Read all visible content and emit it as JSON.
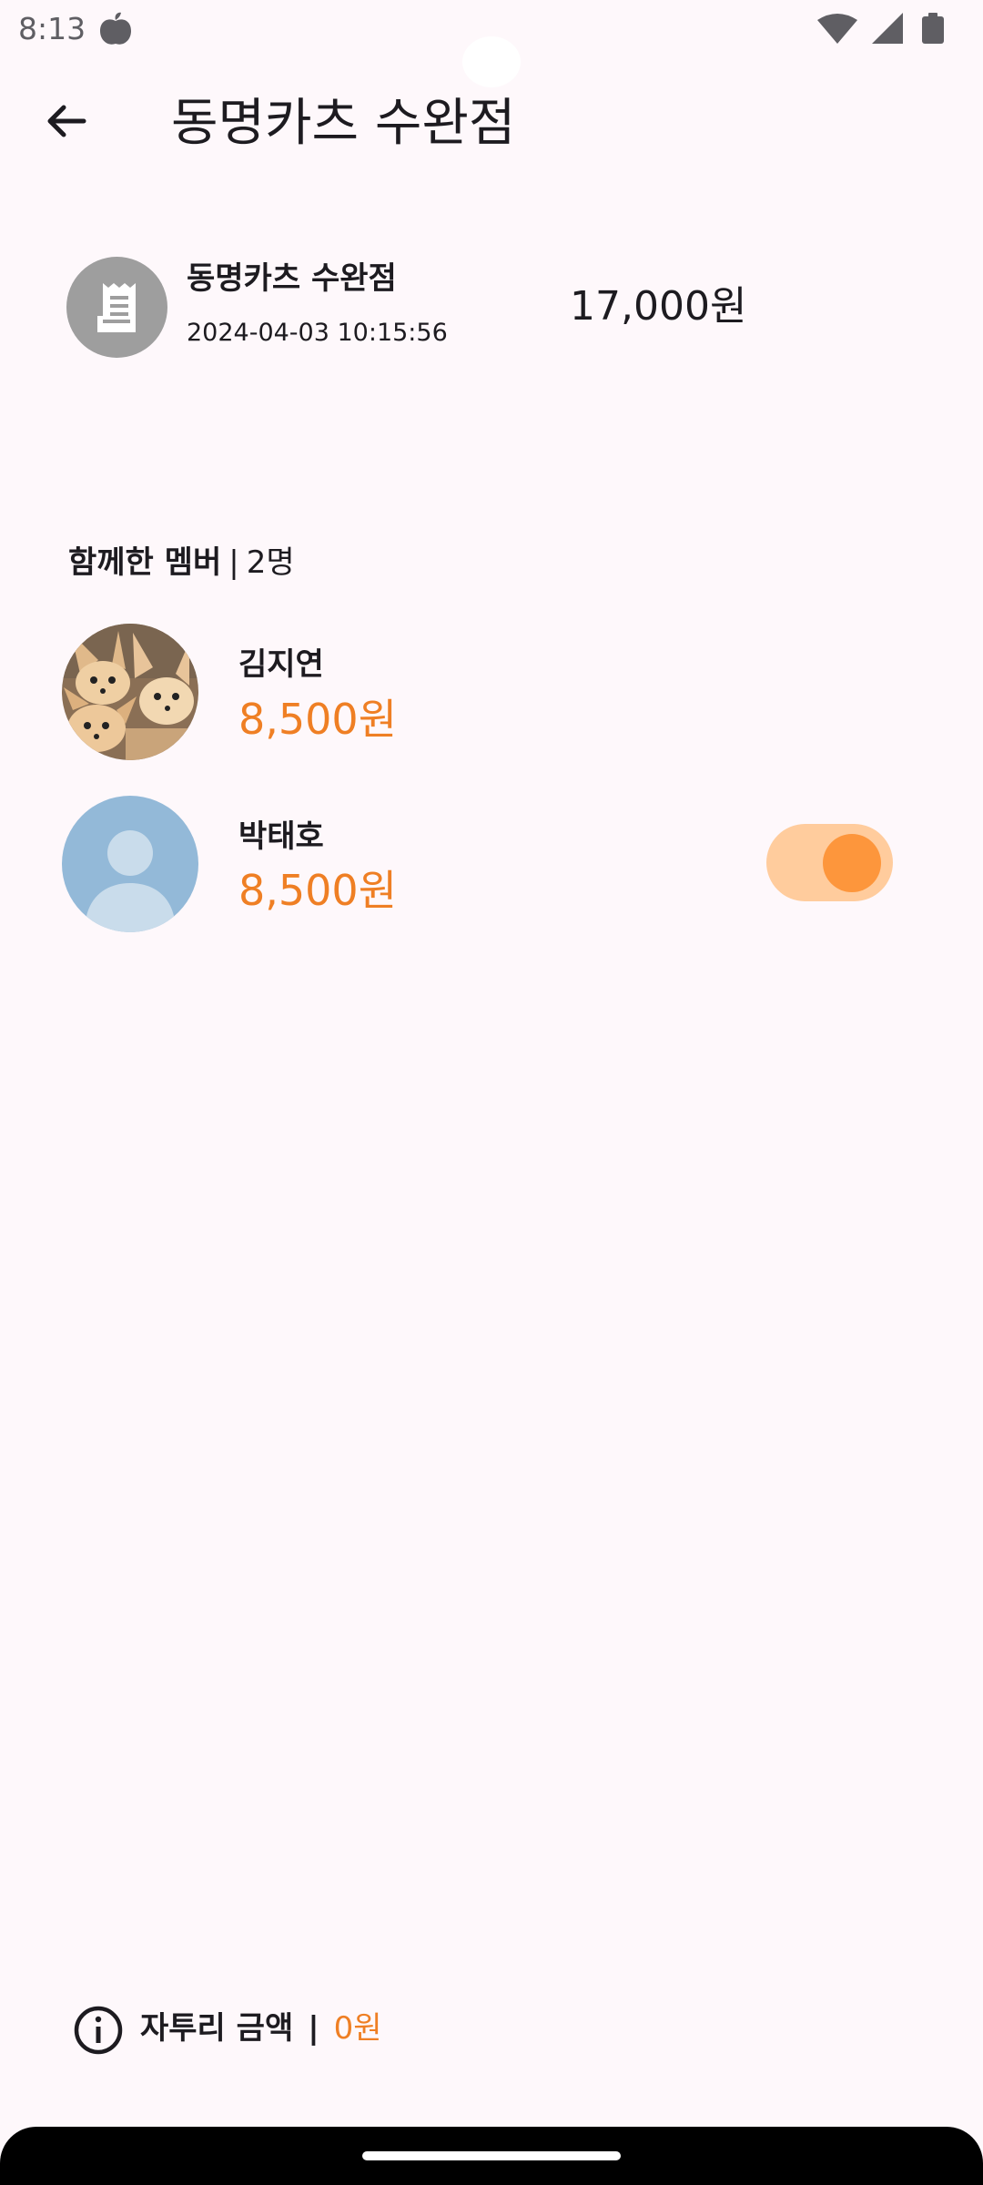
{
  "status_bar": {
    "time": "8:13"
  },
  "header": {
    "title": "동명카츠 수완점"
  },
  "receipt": {
    "store_name": "동명카츠 수완점",
    "datetime": "2024-04-03 10:15:56",
    "total": "17,000원"
  },
  "members": {
    "label": "함께한 멤버",
    "separator": "|",
    "count": "2명",
    "list": [
      {
        "name": "김지연",
        "amount": "8,500원",
        "avatar": "fennec-fox-photo"
      },
      {
        "name": "박태호",
        "amount": "8,500원",
        "avatar": "default-person-icon",
        "toggle_on": true
      }
    ]
  },
  "footer": {
    "label": "자투리 금액",
    "separator": "|",
    "amount": "0원",
    "icon": "info-icon"
  },
  "colors": {
    "background": "#fef8fb",
    "accent": "#ef7f24",
    "toggle_track": "#ffcc9d",
    "toggle_thumb": "#fd963c",
    "receipt_avatar": "#9e9e9e",
    "default_avatar": "#93b9d8"
  }
}
